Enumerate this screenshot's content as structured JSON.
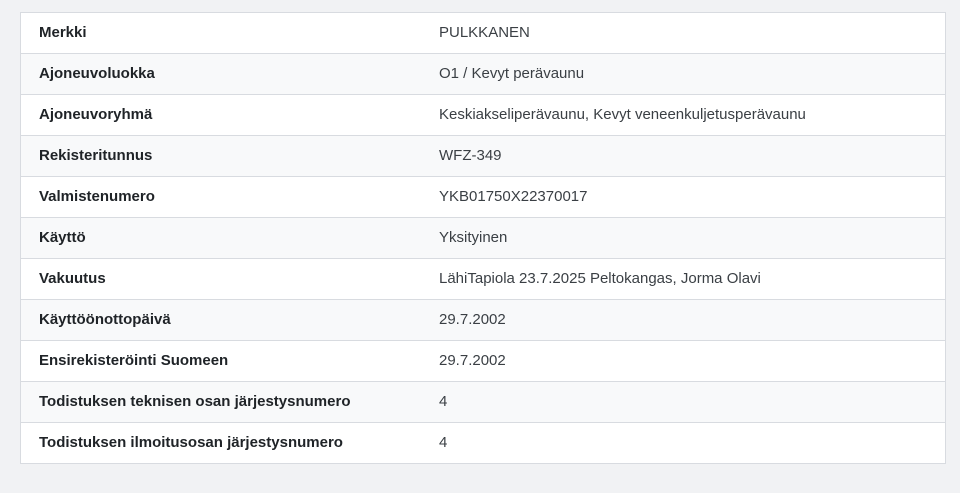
{
  "page": {
    "background_color": "#f1f2f4"
  },
  "vehicle_info_table": {
    "striped_row_color": "#f8f9fa",
    "row_color": "#ffffff",
    "border_color": "#d8dbe0",
    "label_color": "#1f2327",
    "value_color": "#3a3f44",
    "rows": [
      {
        "label": "Merkki",
        "value": "PULKKANEN"
      },
      {
        "label": "Ajoneuvoluokka",
        "value": "O1 / Kevyt perävaunu"
      },
      {
        "label": "Ajoneuvoryhmä",
        "value": "Keskiakseliperävaunu, Kevyt veneenkuljetusperävaunu"
      },
      {
        "label": "Rekisteritunnus",
        "value": "WFZ-349"
      },
      {
        "label": "Valmistenumero",
        "value": "YKB01750X22370017"
      },
      {
        "label": "Käyttö",
        "value": "Yksityinen"
      },
      {
        "label": "Vakuutus",
        "value": "LähiTapiola 23.7.2025 Peltokangas, Jorma Olavi"
      },
      {
        "label": "Käyttöönottopäivä",
        "value": "29.7.2002"
      },
      {
        "label": "Ensirekisteröinti Suomeen",
        "value": "29.7.2002"
      },
      {
        "label": "Todistuksen teknisen osan järjestysnumero",
        "value": "4"
      },
      {
        "label": "Todistuksen ilmoitusosan järjestysnumero",
        "value": "4"
      }
    ]
  }
}
